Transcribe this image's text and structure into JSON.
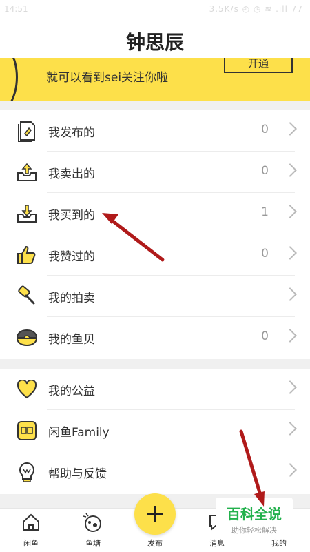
{
  "status_bar": {
    "time": "14:51",
    "right": "3.5K/s  ◴ ◷  ≋ .ıll 77"
  },
  "header": {
    "title": "钟思辰"
  },
  "banner": {
    "text": "就可以看到sei关注你啦",
    "button_label": "开通"
  },
  "menu_group_1": [
    {
      "icon": "publish-doc-icon",
      "label": "我发布的",
      "count": "0"
    },
    {
      "icon": "sold-box-icon",
      "label": "我卖出的",
      "count": "0"
    },
    {
      "icon": "bought-box-icon",
      "label": "我买到的",
      "count": "1"
    },
    {
      "icon": "thumbs-up-icon",
      "label": "我赞过的",
      "count": "0"
    },
    {
      "icon": "auction-hammer-icon",
      "label": "我的拍卖",
      "count": ""
    },
    {
      "icon": "shell-icon",
      "label": "我的鱼贝",
      "count": "0"
    }
  ],
  "menu_group_2": [
    {
      "icon": "heart-icon",
      "label": "我的公益",
      "count": ""
    },
    {
      "icon": "family-icon",
      "label": "闲鱼Family",
      "count": ""
    },
    {
      "icon": "help-bulb-icon",
      "label": "帮助与反馈",
      "count": ""
    }
  ],
  "tab_bar": {
    "tabs": [
      {
        "icon": "home-icon",
        "label": "闲鱼"
      },
      {
        "icon": "pond-icon",
        "label": "鱼塘"
      },
      {
        "icon": "plus-icon",
        "label": "发布"
      },
      {
        "icon": "message-icon",
        "label": "消息"
      },
      {
        "icon": "profile-icon",
        "label": "我的"
      }
    ]
  },
  "watermark": {
    "title": "百科全说",
    "subtitle": "助你轻松解决"
  },
  "colors": {
    "accent": "#fde04a",
    "annotation_arrow": "#b01a1a",
    "watermark_green": "#23b14d"
  }
}
